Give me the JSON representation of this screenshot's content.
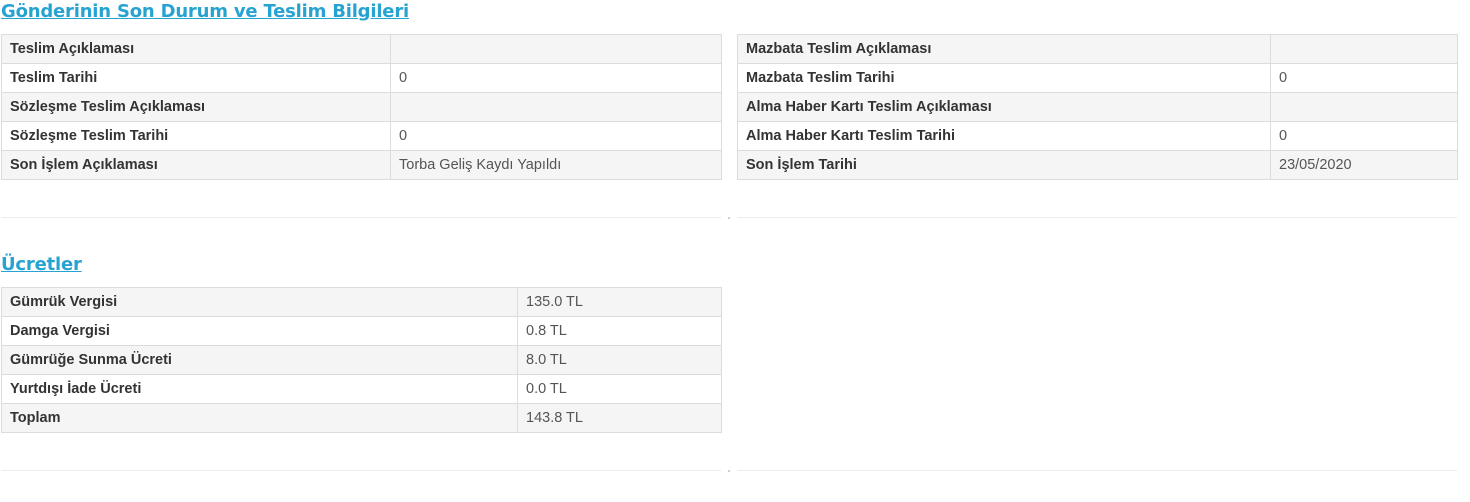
{
  "delivery": {
    "title": "Gönderinin Son Durum ve Teslim Bilgileri",
    "left_rows": [
      {
        "label": "Teslim Açıklaması",
        "value": ""
      },
      {
        "label": "Teslim Tarihi",
        "value": "0"
      },
      {
        "label": "Sözleşme Teslim Açıklaması",
        "value": ""
      },
      {
        "label": "Sözleşme Teslim Tarihi",
        "value": "0"
      },
      {
        "label": "Son İşlem Açıklaması",
        "value": "Torba Geliş Kaydı Yapıldı"
      }
    ],
    "right_rows": [
      {
        "label": "Mazbata Teslim Açıklaması",
        "value": ""
      },
      {
        "label": "Mazbata Teslim Tarihi",
        "value": "0"
      },
      {
        "label": "Alma Haber Kartı Teslim Açıklaması",
        "value": ""
      },
      {
        "label": "Alma Haber Kartı Teslim Tarihi",
        "value": "0"
      },
      {
        "label": "Son İşlem Tarihi",
        "value": "23/05/2020"
      }
    ]
  },
  "fees": {
    "title": "Ücretler",
    "rows": [
      {
        "label": "Gümrük Vergisi",
        "value": "135.0 TL"
      },
      {
        "label": "Damga Vergisi",
        "value": "0.8 TL"
      },
      {
        "label": "Gümrüğe Sunma Ücreti",
        "value": "8.0 TL"
      },
      {
        "label": "Yurtdışı İade Ücreti",
        "value": "0.0 TL"
      },
      {
        "label": "Toplam",
        "value": "143.8 TL"
      }
    ]
  },
  "colors": {
    "title_link": "#27a3d2",
    "row_stripe": "#f5f5f5",
    "border": "#dcdcdc"
  }
}
